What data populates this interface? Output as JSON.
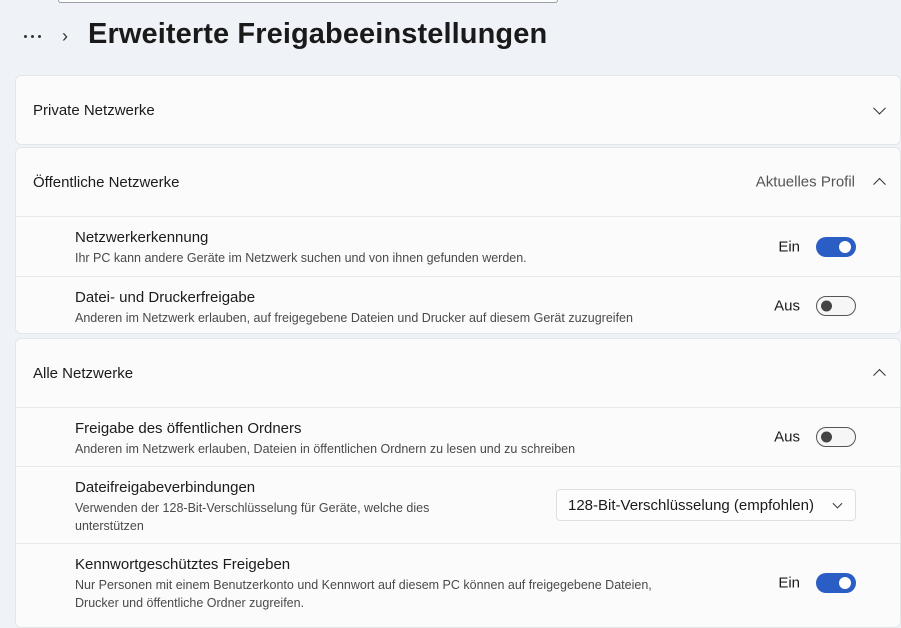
{
  "header": {
    "title": "Erweiterte Freigabeeinstellungen",
    "separator": "›"
  },
  "sections": {
    "private": {
      "title": "Private Netzwerke"
    },
    "public": {
      "title": "Öffentliche Netzwerke",
      "aux": "Aktuelles Profil",
      "rows": {
        "discovery": {
          "title": "Netzwerkerkennung",
          "desc": "Ihr PC kann andere Geräte im Netzwerk suchen und von ihnen gefunden werden.",
          "state": "Ein",
          "on": true
        },
        "sharing": {
          "title": "Datei- und Druckerfreigabe",
          "desc": "Anderen im Netzwerk erlauben, auf freigegebene Dateien und Drucker auf diesem Gerät zuzugreifen",
          "state": "Aus",
          "on": false
        }
      }
    },
    "all": {
      "title": "Alle Netzwerke",
      "rows": {
        "public_folder": {
          "title": "Freigabe des öffentlichen Ordners",
          "desc": "Anderen im Netzwerk erlauben, Dateien in öffentlichen Ordnern zu lesen und zu schreiben",
          "state": "Aus",
          "on": false
        },
        "connections": {
          "title": "Dateifreigabeverbindungen",
          "desc_line1": "Verwenden der 128-Bit-Verschlüsselung für Geräte, welche dies",
          "desc_line2": "unterstützen",
          "selected": "128-Bit-Verschlüsselung (empfohlen)"
        },
        "password": {
          "title": "Kennwortgeschütztes Freigeben",
          "desc_line1": "Nur Personen mit einem Benutzerkonto und Kennwort auf diesem PC können auf freigegebene Dateien,",
          "desc_line2": "Drucker und öffentliche Ordner zugreifen.",
          "state": "Ein",
          "on": true
        }
      }
    }
  },
  "colors": {
    "accent": "#2a5ec4",
    "background": "#eff3f8",
    "card": "#fbfbfb"
  }
}
